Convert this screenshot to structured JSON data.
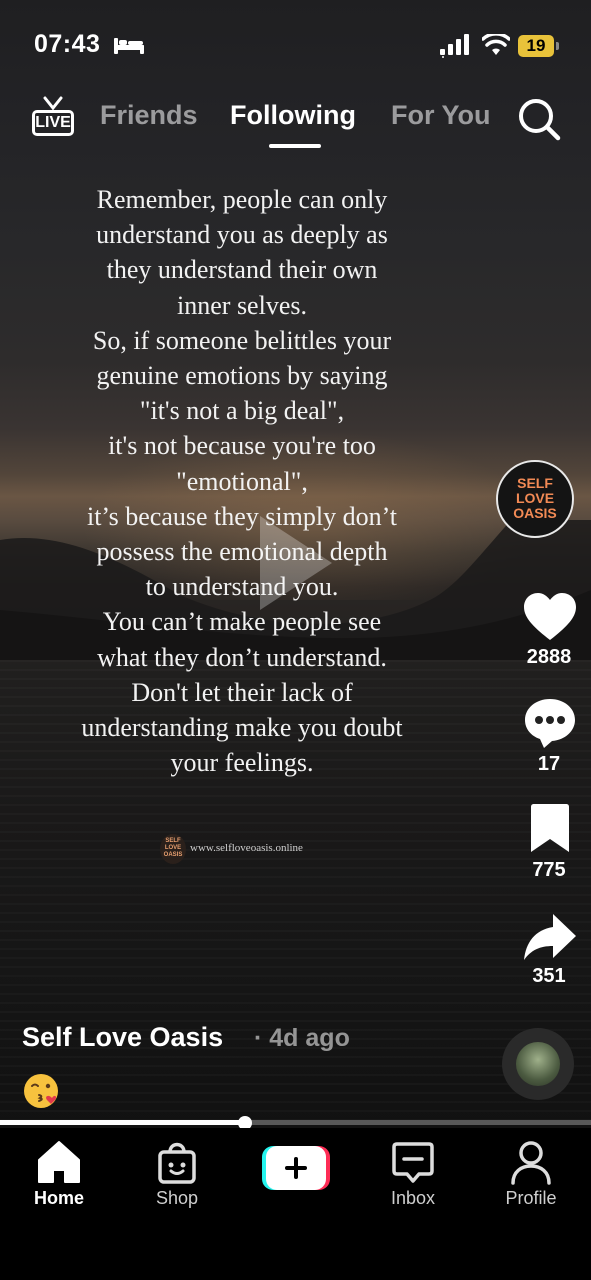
{
  "status_bar": {
    "time": "07:43",
    "battery": "19",
    "icons": [
      "bed-icon",
      "signal-icon",
      "wifi-icon",
      "battery-icon"
    ]
  },
  "top_nav": {
    "live_label": "LIVE",
    "tabs": [
      {
        "label": "Friends",
        "active": false
      },
      {
        "label": "Following",
        "active": true
      },
      {
        "label": "For You",
        "active": false
      }
    ],
    "icons": [
      "live-icon",
      "search-icon"
    ]
  },
  "video": {
    "quote_lines": [
      "Remember, people can only",
      "understand you as deeply as",
      "they understand their own",
      "inner selves.",
      "So, if someone belittles your",
      "genuine emotions by saying",
      "\"it's not a big deal\",",
      "it's not because you're too",
      "\"emotional\",",
      "it’s because they simply don’t",
      "possess the emotional depth",
      "to understand you.",
      "You can’t make people see",
      "what they don’t understand.",
      "Don't let their lack of",
      "understanding make you doubt",
      "your feelings."
    ],
    "watermark_logo": "SELF LOVE OASIS",
    "watermark_url": "www.selfloveoasis.online",
    "progress_fraction": 0.415
  },
  "right_rail": {
    "creator_avatar_text": [
      "SELF",
      "LOVE",
      "OASIS"
    ],
    "likes": "2888",
    "comments": "17",
    "saves": "775",
    "shares": "351"
  },
  "caption": {
    "author": "Self Love Oasis",
    "age": "· 4d ago",
    "emoji": "😘"
  },
  "bottom_nav": {
    "items": [
      {
        "label": "Home",
        "icon": "home-icon",
        "active": true
      },
      {
        "label": "Shop",
        "icon": "shopping-bag-icon",
        "active": false
      },
      {
        "label": "",
        "icon": "plus-icon",
        "active": false
      },
      {
        "label": "Inbox",
        "icon": "inbox-icon",
        "active": false
      },
      {
        "label": "Profile",
        "icon": "profile-icon",
        "active": false
      }
    ]
  },
  "colors": {
    "accent_cyan": "#25f4ee",
    "accent_red": "#fe2c55",
    "avatar_text": "#f28a55",
    "battery": "#e8c23a"
  }
}
